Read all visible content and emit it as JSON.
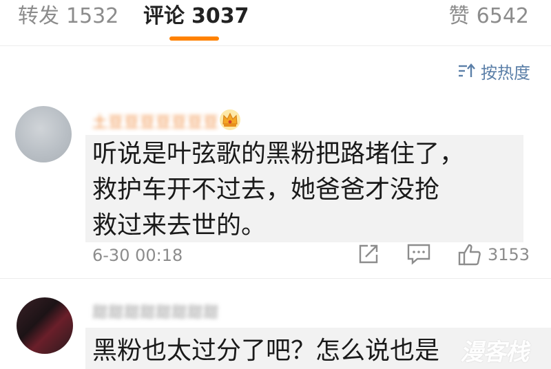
{
  "tabs": {
    "repost": {
      "label": "转发",
      "count": "1532"
    },
    "comments": {
      "label": "评论",
      "count": "3037"
    },
    "likes": {
      "label": "赞",
      "count": "6542"
    }
  },
  "sort": {
    "label": "按热度",
    "icon": "sort-icon"
  },
  "comments": [
    {
      "username": "土豆豆豆豆豆豆豆",
      "badge_icon": "vip-crown-icon",
      "lines": [
        "听说是叶弦歌的黑粉把路堵住了，",
        "救护车开不过去，她爸爸才没抢",
        "救过来去世的。"
      ],
      "time": "6-30 00:18",
      "like_count": "3153"
    },
    {
      "username": "甜甜甜甜甜甜甜甜",
      "lines": [
        "黑粉也太过分了吧？怎么说也是"
      ]
    }
  ],
  "watermark": "漫客栈",
  "colors": {
    "accent": "#ff8200",
    "link": "#5b7fa8",
    "username": "#f08a3c"
  }
}
